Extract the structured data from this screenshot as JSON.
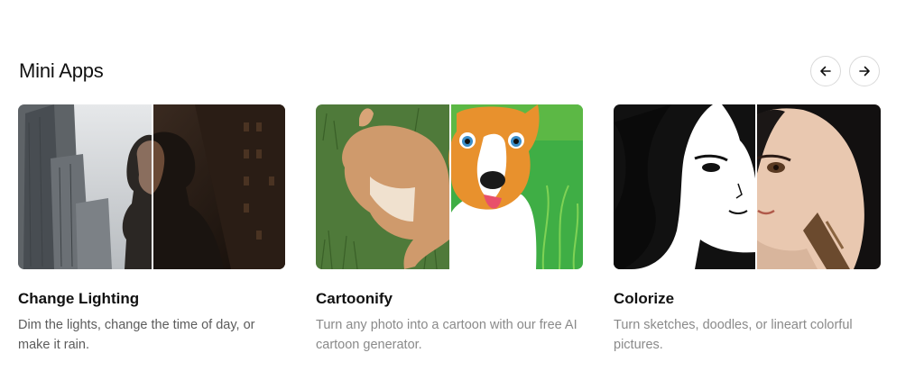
{
  "section": {
    "title": "Mini Apps"
  },
  "nav": {
    "prev_icon": "arrow-left-icon",
    "next_icon": "arrow-right-icon"
  },
  "cards": [
    {
      "title": "Change Lighting",
      "description": "Dim the lights, change the time of day, or make it rain.",
      "image": "portrait-man-city-lighting-split"
    },
    {
      "title": "Cartoonify",
      "description": "Turn any photo into a cartoon with our free AI cartoon generator.",
      "image": "dog-photo-cartoon-split"
    },
    {
      "title": "Colorize",
      "description": "Turn sketches, doodles, or lineart colorful pictures.",
      "image": "anime-girl-lineart-color-split"
    }
  ]
}
